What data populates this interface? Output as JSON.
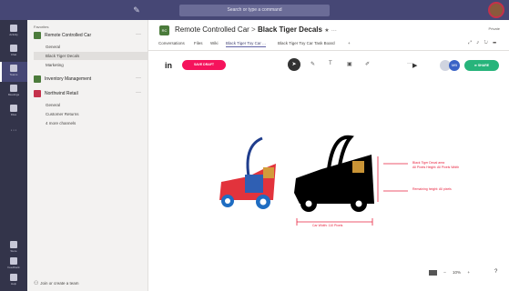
{
  "topbar": {
    "search_placeholder": "Search or type a command",
    "compose_glyph": "✎"
  },
  "rail": {
    "items": [
      {
        "label": "Activity",
        "icon": "bell-icon"
      },
      {
        "label": "Chat",
        "icon": "chat-icon"
      },
      {
        "label": "Teams",
        "icon": "teams-icon"
      },
      {
        "label": "Meetings",
        "icon": "calendar-icon"
      },
      {
        "label": "Files",
        "icon": "files-icon"
      },
      {
        "label": "···",
        "icon": "more-apps-icon"
      }
    ],
    "bottom": [
      {
        "label": "Store",
        "icon": "store-icon"
      },
      {
        "label": "Feedback",
        "icon": "feedback-icon"
      },
      {
        "label": "Help",
        "icon": "help-icon"
      }
    ]
  },
  "teams_pane": {
    "section_label": "Favorites",
    "teams": [
      {
        "name": "Remote Controlled Car",
        "color": "#4b7b3b",
        "channels": [
          "General",
          "Black Tiger Decals",
          "Marketing"
        ]
      },
      {
        "name": "Inventory Management",
        "color": "#4b7b3b",
        "channels": []
      },
      {
        "name": "Northwind Retail",
        "color": "#c4314b",
        "channels": [
          "General",
          "Customer Returns",
          "4 more channels"
        ]
      }
    ],
    "join_label": "Join or create a team"
  },
  "header": {
    "team_tile": "RC",
    "team_name": "Remote Controlled Car",
    "separator": ">",
    "channel_name": "Black Tiger Decals",
    "private_label": "Private",
    "tabs": [
      "Conversations",
      "Files",
      "Wiki",
      "Black Tiger Toy Car ...",
      "Black Tiger Toy Car Task Board",
      "+"
    ]
  },
  "invision": {
    "logo": "in",
    "save_draft": "SAVE DRAFT",
    "share": "SHARE",
    "avatar_initials": "MB"
  },
  "annotations": {
    "decal_line1": "Black Tiger Decal area",
    "decal_line2": "All Pixels Height: All Pixels Width",
    "remaining": "Remaining height: All pixels",
    "width": "Car Width: 110 Pixels"
  },
  "zoom": {
    "minus": "–",
    "value": "10%",
    "plus": "+",
    "help": "?"
  },
  "colors": {
    "topbar": "#464775",
    "rail": "#33344a",
    "save_draft": "#f5135c",
    "share": "#27b47b",
    "annotation": "#e8233f"
  }
}
